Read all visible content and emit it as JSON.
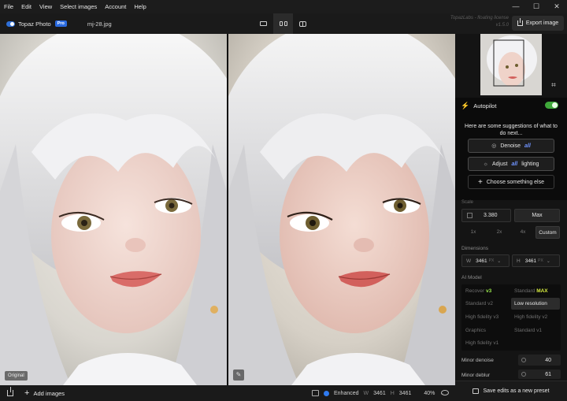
{
  "menu": [
    "File",
    "Edit",
    "View",
    "Select images",
    "Account",
    "Help"
  ],
  "window_controls": [
    "—",
    "☐",
    "✕"
  ],
  "toolbar": {
    "brand": "Topaz Photo",
    "badge": "Pro",
    "filename": "mj-28.jpg"
  },
  "license": {
    "line1": "TopazLabs - floating license",
    "line2": "v1.5.0"
  },
  "export_label": "Export image",
  "canvas": {
    "left_tag": "Original",
    "right_tag_icon": "pencil-icon"
  },
  "status": {
    "add_images": "Add images",
    "enhanced": "Enhanced",
    "w_label": "W",
    "w_value": "3461",
    "h_label": "H",
    "h_value": "3461",
    "zoom": "40%"
  },
  "autopilot": {
    "label": "Autopilot",
    "enabled": true,
    "intro": "Here are some suggestions of what to do next...",
    "denoise_prefix": "Denoise",
    "denoise_hl": "all",
    "adjust_prefix": "Adjust",
    "adjust_hl": "all",
    "adjust_suffix": "lighting",
    "choose": "Choose something else"
  },
  "scale": {
    "label": "Scale",
    "value": "3.380",
    "max": "Max",
    "options": [
      "1x",
      "2x",
      "4x",
      "Custom"
    ]
  },
  "dimensions": {
    "label": "Dimensions",
    "w_key": "W",
    "w_value": "3461",
    "w_unit": "PX",
    "h_key": "H",
    "h_value": "3461",
    "h_unit": "PX"
  },
  "ai_model": {
    "label": "AI Model",
    "recover": "Recover",
    "recover_ver": "v3",
    "standard": "Standard",
    "standard_max": "MAX",
    "standard_v2": "Standard v2",
    "low_res": "Low resolution",
    "hfv3": "High fidelity v3",
    "hfv2": "High fidelity v2",
    "graphics": "Graphics",
    "standard_v1": "Standard v1",
    "hfv1": "High fidelity v1"
  },
  "sliders": {
    "minor_denoise_label": "Minor denoise",
    "minor_denoise_value": "40",
    "minor_deblur_label": "Minor deblur",
    "minor_deblur_value": "61"
  },
  "save_preset": "Save edits as a new preset",
  "colors": {
    "accent_blue": "#2b6be0",
    "autopilot_green": "#3fa83a",
    "recover_green": "#9bea4e",
    "max_yellow": "#d6ea3f"
  }
}
